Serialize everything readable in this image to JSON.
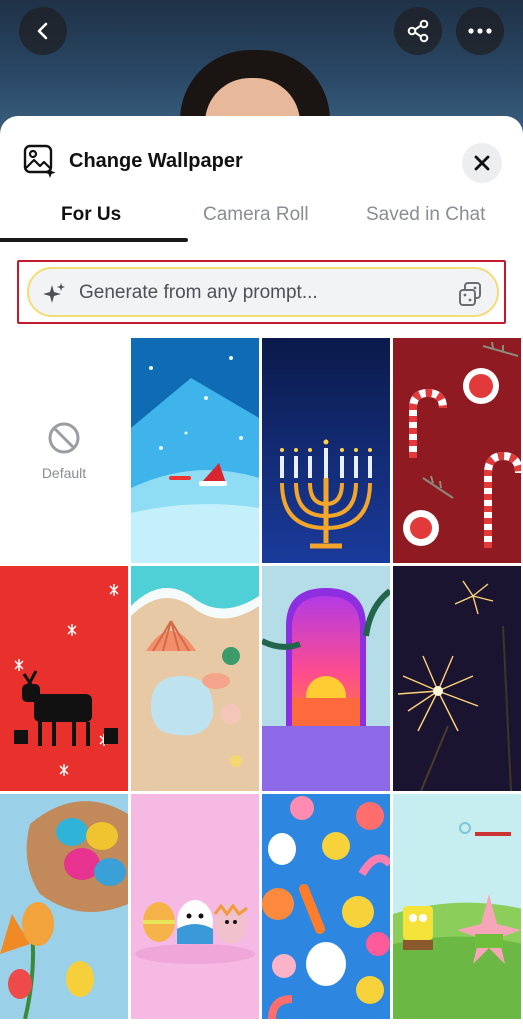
{
  "top_bar": {
    "back_icon": "chevron-left-icon",
    "share_icon": "share-icon",
    "more_icon": "more-horizontal-icon"
  },
  "sheet": {
    "title": "Change Wallpaper",
    "close_icon": "close-icon",
    "tabs": [
      {
        "label": "For Us",
        "active": true
      },
      {
        "label": "Camera Roll",
        "active": false
      },
      {
        "label": "Saved in Chat",
        "active": false
      }
    ],
    "prompt": {
      "placeholder": "Generate from any prompt...",
      "sparkle_icon": "sparkle-icon",
      "dice_icon": "dice-icon"
    },
    "default_label": "Default",
    "wallpapers": [
      "winter-snow-beach",
      "menorah",
      "candy-canes",
      "reindeer-red",
      "beach-shells",
      "sunset-arch",
      "fireworks",
      "easter-eggs-basket",
      "easter-egg-characters",
      "sticker-pattern",
      "spongebob-patrick"
    ]
  },
  "colors": {
    "highlight_outline": "#c41a2e",
    "prompt_border": "#f3dc75"
  }
}
